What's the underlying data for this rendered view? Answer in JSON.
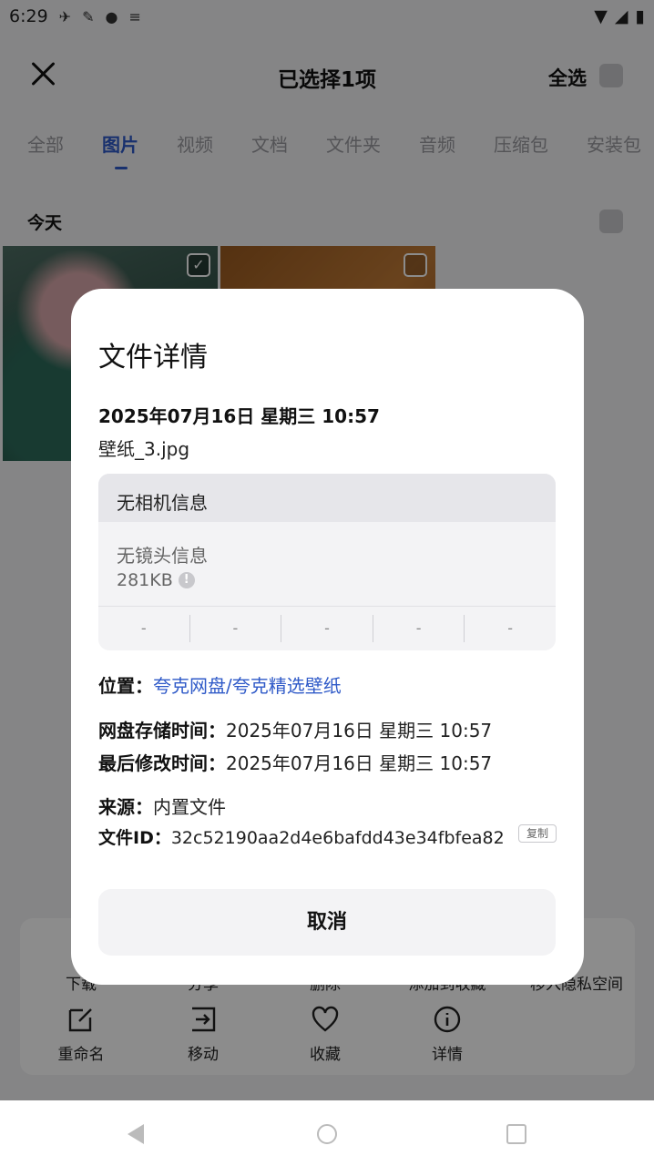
{
  "status_bar": {
    "time": "6:29"
  },
  "header": {
    "title": "已选择1项",
    "select_all": "全选"
  },
  "tabs": [
    "全部",
    "图片",
    "视频",
    "文档",
    "文件夹",
    "音频",
    "压缩包",
    "安装包"
  ],
  "section": {
    "today": "今天"
  },
  "action_panel": {
    "row1": [
      "下载",
      "分享",
      "删除",
      "添加到收藏",
      "移入隐私空间"
    ],
    "rename": "重命名",
    "move": "移动",
    "favorite": "收藏",
    "details": "详情"
  },
  "dialog": {
    "title": "文件详情",
    "date": "2025年07月16日 星期三 10:57",
    "filename": "壁纸_3.jpg",
    "camera": "无相机信息",
    "lens": "无镜头信息",
    "size": "281KB",
    "params": [
      "-",
      "-",
      "-",
      "-",
      "-"
    ],
    "location_label": "位置：",
    "location_value": "夸克网盘/夸克精选壁纸",
    "stored_label": "网盘存储时间：",
    "stored_value": "2025年07月16日 星期三 10:57",
    "modified_label": "最后修改时间：",
    "modified_value": "2025年07月16日 星期三 10:57",
    "source_label": "来源：",
    "source_value": "内置文件",
    "fileid_label": "文件ID：",
    "fileid_value": "32c52190aa2d4e6bafdd43e34fbfea82",
    "copy": "复制",
    "cancel": "取消"
  },
  "colors": {
    "accent": "#2f5ac8",
    "scrim": "rgba(0,0,0,0.45)"
  }
}
